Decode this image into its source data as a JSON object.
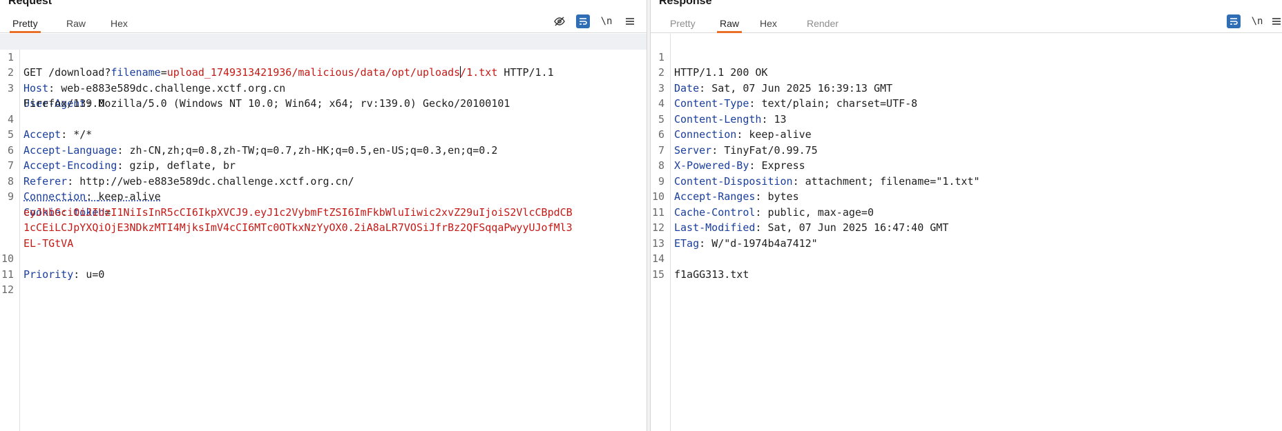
{
  "request": {
    "title": "Request",
    "tabs": [
      "Pretty",
      "Raw",
      "Hex"
    ],
    "active_tab": "Pretty",
    "toolbar": {
      "newline_label": "\\n"
    },
    "lines": {
      "l1": {
        "num": "1",
        "method": "GET /download?",
        "param": "filename",
        "eq": "=",
        "value_a": "upload_1749313421936/malicious/data/opt/uploads",
        "value_b": "/1.txt",
        "tail": " HTTP/1.1"
      },
      "l2": {
        "num": "2",
        "key": "Host",
        "value": "web-e883e589dc.challenge.xctf.org.cn"
      },
      "l3": {
        "num": "3",
        "key": "User-Agent",
        "value": "Mozilla/5.0 (Windows NT 10.0; Win64; x64; rv:139.0) Gecko/20100101",
        "cont": "Firefox/139.0"
      },
      "l4": {
        "num": "4",
        "key": "Accept",
        "value": "*/*"
      },
      "l5": {
        "num": "5",
        "key": "Accept-Language",
        "value": "zh-CN,zh;q=0.8,zh-TW;q=0.7,zh-HK;q=0.5,en-US;q=0.3,en;q=0.2"
      },
      "l6": {
        "num": "6",
        "key": "Accept-Encoding",
        "value": "gzip, deflate, br"
      },
      "l7": {
        "num": "7",
        "key": "Referer",
        "value": "http://web-e883e589dc.challenge.xctf.org.cn/"
      },
      "l8": {
        "num": "8",
        "key": "Connection",
        "value": "keep-alive"
      },
      "l9": {
        "num": "9",
        "key": "Cookie",
        "cookie_name": "token",
        "eq": "=",
        "token_1": "eyJhbGciOiJIUzI1NiIsInR5cCI6IkpXVCJ9.eyJ1c2VybmFtZSI6ImFkbWluIiwic2xvZ29uIjoiS2VlcCBpdCB",
        "token_2": "1cCEiLCJpYXQiOjE3NDkzMTI4MjksImV4cCI6MTc0OTkxNzYyOX0.2iA8aLR7VOSiJfrBz2QFSqqaPwyyUJofMl3",
        "token_3": "EL-TGtVA"
      },
      "l10": {
        "num": "10",
        "key": "Priority",
        "value": "u=0"
      },
      "l11": {
        "num": "11"
      },
      "l12": {
        "num": "12"
      }
    }
  },
  "response": {
    "title": "Response",
    "tabs": [
      "Pretty",
      "Raw",
      "Hex",
      "Render"
    ],
    "active_tab": "Raw",
    "toolbar": {
      "newline_label": "\\n"
    },
    "lines": {
      "l1": {
        "num": "1",
        "status": "HTTP/1.1 200 OK"
      },
      "l2": {
        "num": "2",
        "key": "Date",
        "value": "Sat, 07 Jun 2025 16:39:13 GMT"
      },
      "l3": {
        "num": "3",
        "key": "Content-Type",
        "value": "text/plain; charset=UTF-8"
      },
      "l4": {
        "num": "4",
        "key": "Content-Length",
        "value": "13"
      },
      "l5": {
        "num": "5",
        "key": "Connection",
        "value": "keep-alive"
      },
      "l6": {
        "num": "6",
        "key": "Server",
        "value": "TinyFat/0.99.75"
      },
      "l7": {
        "num": "7",
        "key": "X-Powered-By",
        "value": "Express"
      },
      "l8": {
        "num": "8",
        "key": "Content-Disposition",
        "value": "attachment; filename=\"1.txt\""
      },
      "l9": {
        "num": "9",
        "key": "Accept-Ranges",
        "value": "bytes"
      },
      "l10": {
        "num": "10",
        "key": "Cache-Control",
        "value": "public, max-age=0"
      },
      "l11": {
        "num": "11",
        "key": "Last-Modified",
        "value": "Sat, 07 Jun 2025 16:47:40 GMT"
      },
      "l12": {
        "num": "12",
        "key": "ETag",
        "value": "W/\"d-1974b4a7412\""
      },
      "l13": {
        "num": "13"
      },
      "l14": {
        "num": "14",
        "body": "f1aGG313.txt"
      },
      "l15": {
        "num": "15"
      }
    }
  },
  "colors": {
    "key": "#1a3e9e",
    "param_value": "#c41a16",
    "active_tab": "#e8702a",
    "icon_box": "#2f6db5"
  },
  "icons": [
    "eye-off-icon",
    "wrap-icon",
    "newline-icon",
    "menu-icon"
  ]
}
